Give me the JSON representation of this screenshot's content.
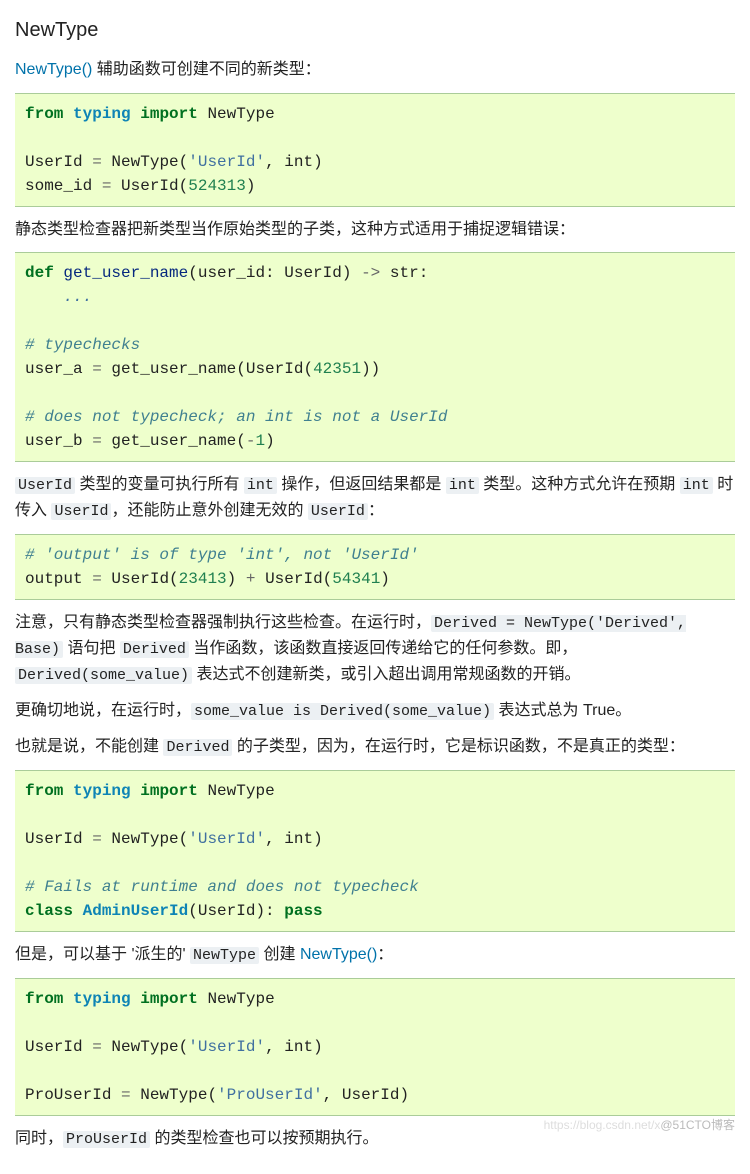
{
  "title": "NewType",
  "intro": {
    "link": "NewType()",
    "text": " 辅助函数可创建不同的新类型："
  },
  "code1": {
    "l1": {
      "from": "from",
      "mod": "typing",
      "import": "import",
      "name": "NewType"
    },
    "l2a": "UserId ",
    "l2eq": "=",
    "l2b": " NewType(",
    "l2s": "'UserId'",
    "l2c": ", ",
    "l2d": "int",
    "l2e": ")",
    "l3a": "some_id ",
    "l3eq": "=",
    "l3b": " UserId(",
    "l3n": "524313",
    "l3c": ")"
  },
  "para2": "静态类型检查器把新类型当作原始类型的子类，这种方式适用于捕捉逻辑错误：",
  "code2": {
    "l1_def": "def",
    "l1_name": " get_user_name",
    "l1_sig1": "(user_id: UserId) ",
    "l1_arrow": "->",
    "l1_sig2": " ",
    "l1_ret": "str",
    "l1_colon": ":",
    "l2_ell": "...",
    "c1": "# typechecks",
    "l3a": "user_a ",
    "l3eq": "=",
    "l3b": " get_user_name(UserId(",
    "l3n": "42351",
    "l3c": "))",
    "c2": "# does not typecheck; an int is not a UserId",
    "l4a": "user_b ",
    "l4eq": "=",
    "l4b": " get_user_name(",
    "l4op": "-",
    "l4n": "1",
    "l4c": ")"
  },
  "para3": {
    "t1": "UserId",
    "t2": " 类型的变量可执行所有 ",
    "t3": "int",
    "t4": " 操作，但返回结果都是 ",
    "t5": "int",
    "t6": " 类型。这种方式允许在预期 ",
    "t7": "int",
    "t8": " 时传入 ",
    "t9": "UserId",
    "t10": "，还能防止意外创建无效的 ",
    "t11": "UserId",
    "t12": "："
  },
  "code3": {
    "c1": "# 'output' is of type 'int', not 'UserId'",
    "l1a": "output ",
    "l1eq": "=",
    "l1b": " UserId(",
    "l1n1": "23413",
    "l1c": ") ",
    "l1plus": "+",
    "l1d": " UserId(",
    "l1n2": "54341",
    "l1e": ")"
  },
  "para4": {
    "t1": "注意，只有静态类型检查器强制执行这些检查。在运行时，",
    "t2": "Derived = NewType('Derived', Base)",
    "t3": " 语句把 ",
    "t4": "Derived",
    "t5": " 当作函数，该函数直接返回传递给它的任何参数。即，",
    "t6": "Derived(some_value)",
    "t7": " 表达式不创建新类，或引入超出调用常规函数的开销。"
  },
  "para5": {
    "t1": "更确切地说，在运行时，",
    "t2": "some_value is Derived(some_value)",
    "t3": " 表达式总为 True。"
  },
  "para6": {
    "t1": "也就是说，不能创建 ",
    "t2": "Derived",
    "t3": " 的子类型，因为，在运行时，它是标识函数，不是真正的类型："
  },
  "code4": {
    "l1": {
      "from": "from",
      "mod": "typing",
      "import": "import",
      "name": "NewType"
    },
    "l2a": "UserId ",
    "l2eq": "=",
    "l2b": " NewType(",
    "l2s": "'UserId'",
    "l2c": ", ",
    "l2d": "int",
    "l2e": ")",
    "c1": "# Fails at runtime and does not typecheck",
    "l3_cls": "class",
    "l3_name": " AdminUserId",
    "l3_sig": "(UserId): ",
    "l3_pass": "pass"
  },
  "para7": {
    "t1": "但是，可以基于 '派生的' ",
    "t2": "NewType",
    "t3": " 创建 ",
    "t4": "NewType()",
    "t5": "："
  },
  "code5": {
    "l1": {
      "from": "from",
      "mod": "typing",
      "import": "import",
      "name": "NewType"
    },
    "l2a": "UserId ",
    "l2eq": "=",
    "l2b": " NewType(",
    "l2s": "'UserId'",
    "l2c": ", ",
    "l2d": "int",
    "l2e": ")",
    "l3a": "ProUserId ",
    "l3eq": "=",
    "l3b": " NewType(",
    "l3s": "'ProUserId'",
    "l3c": ", UserId)"
  },
  "para8": {
    "t1": "同时，",
    "t2": "ProUserId",
    "t3": " 的类型检查也可以按预期执行。"
  },
  "watermark": {
    "t1": "https://blog.csdn.net/x",
    "t2": "@51CTO博客"
  }
}
